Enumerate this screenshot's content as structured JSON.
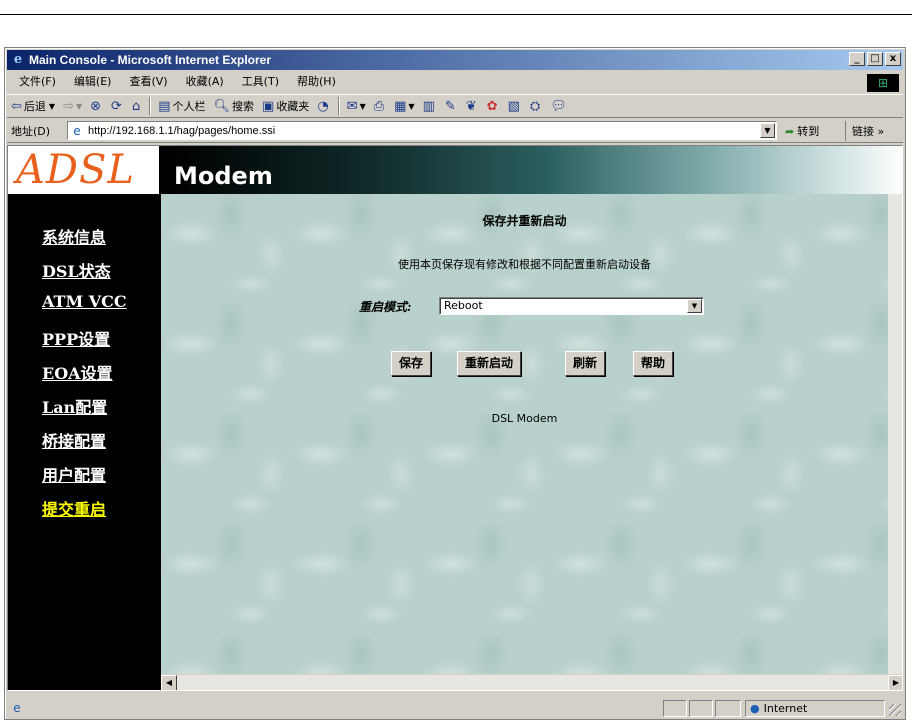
{
  "window": {
    "title": "Main Console - Microsoft Internet Explorer",
    "minimize": "_",
    "maximize": "□",
    "close": "x"
  },
  "menu": [
    "文件(F)",
    "编辑(E)",
    "查看(V)",
    "收藏(A)",
    "工具(T)",
    "帮助(H)"
  ],
  "toolbar": {
    "back": "后退",
    "search": "搜索",
    "personal_bar": "个人栏",
    "favorites": "收藏夹"
  },
  "address": {
    "label": "地址(D)",
    "url": "http://192.168.1.1/hag/pages/home.ssi",
    "go": "转到",
    "links": "链接 »"
  },
  "banner": {
    "logo_text": "ADSL",
    "product": "Modem"
  },
  "nav": {
    "items": [
      {
        "label": "系统信息"
      },
      {
        "label": "DSL状态"
      },
      {
        "label": "ATM VCC"
      },
      {
        "label": "PPP设置"
      },
      {
        "label": "EOA设置"
      },
      {
        "label": "Lan配置"
      },
      {
        "label": "桥接配置"
      },
      {
        "label": "用户配置"
      },
      {
        "label": "提交重启",
        "active": true
      }
    ]
  },
  "main": {
    "heading": "保存并重新启动",
    "description": "使用本页保存现有修改和根据不同配置重新启动设备",
    "mode_label": "重启模式:",
    "mode_value": "Reboot",
    "buttons": {
      "save": "保存",
      "reboot": "重新启动",
      "refresh": "刷新",
      "help": "帮助"
    },
    "footer": "DSL Modem"
  },
  "status": {
    "zone": "Internet"
  },
  "colors": {
    "sidebar_bg": "#000000",
    "nav_link": "#ffffff",
    "nav_active": "#ffff00",
    "logo": "#e8601c",
    "content_bg": "#b9d1cd"
  }
}
